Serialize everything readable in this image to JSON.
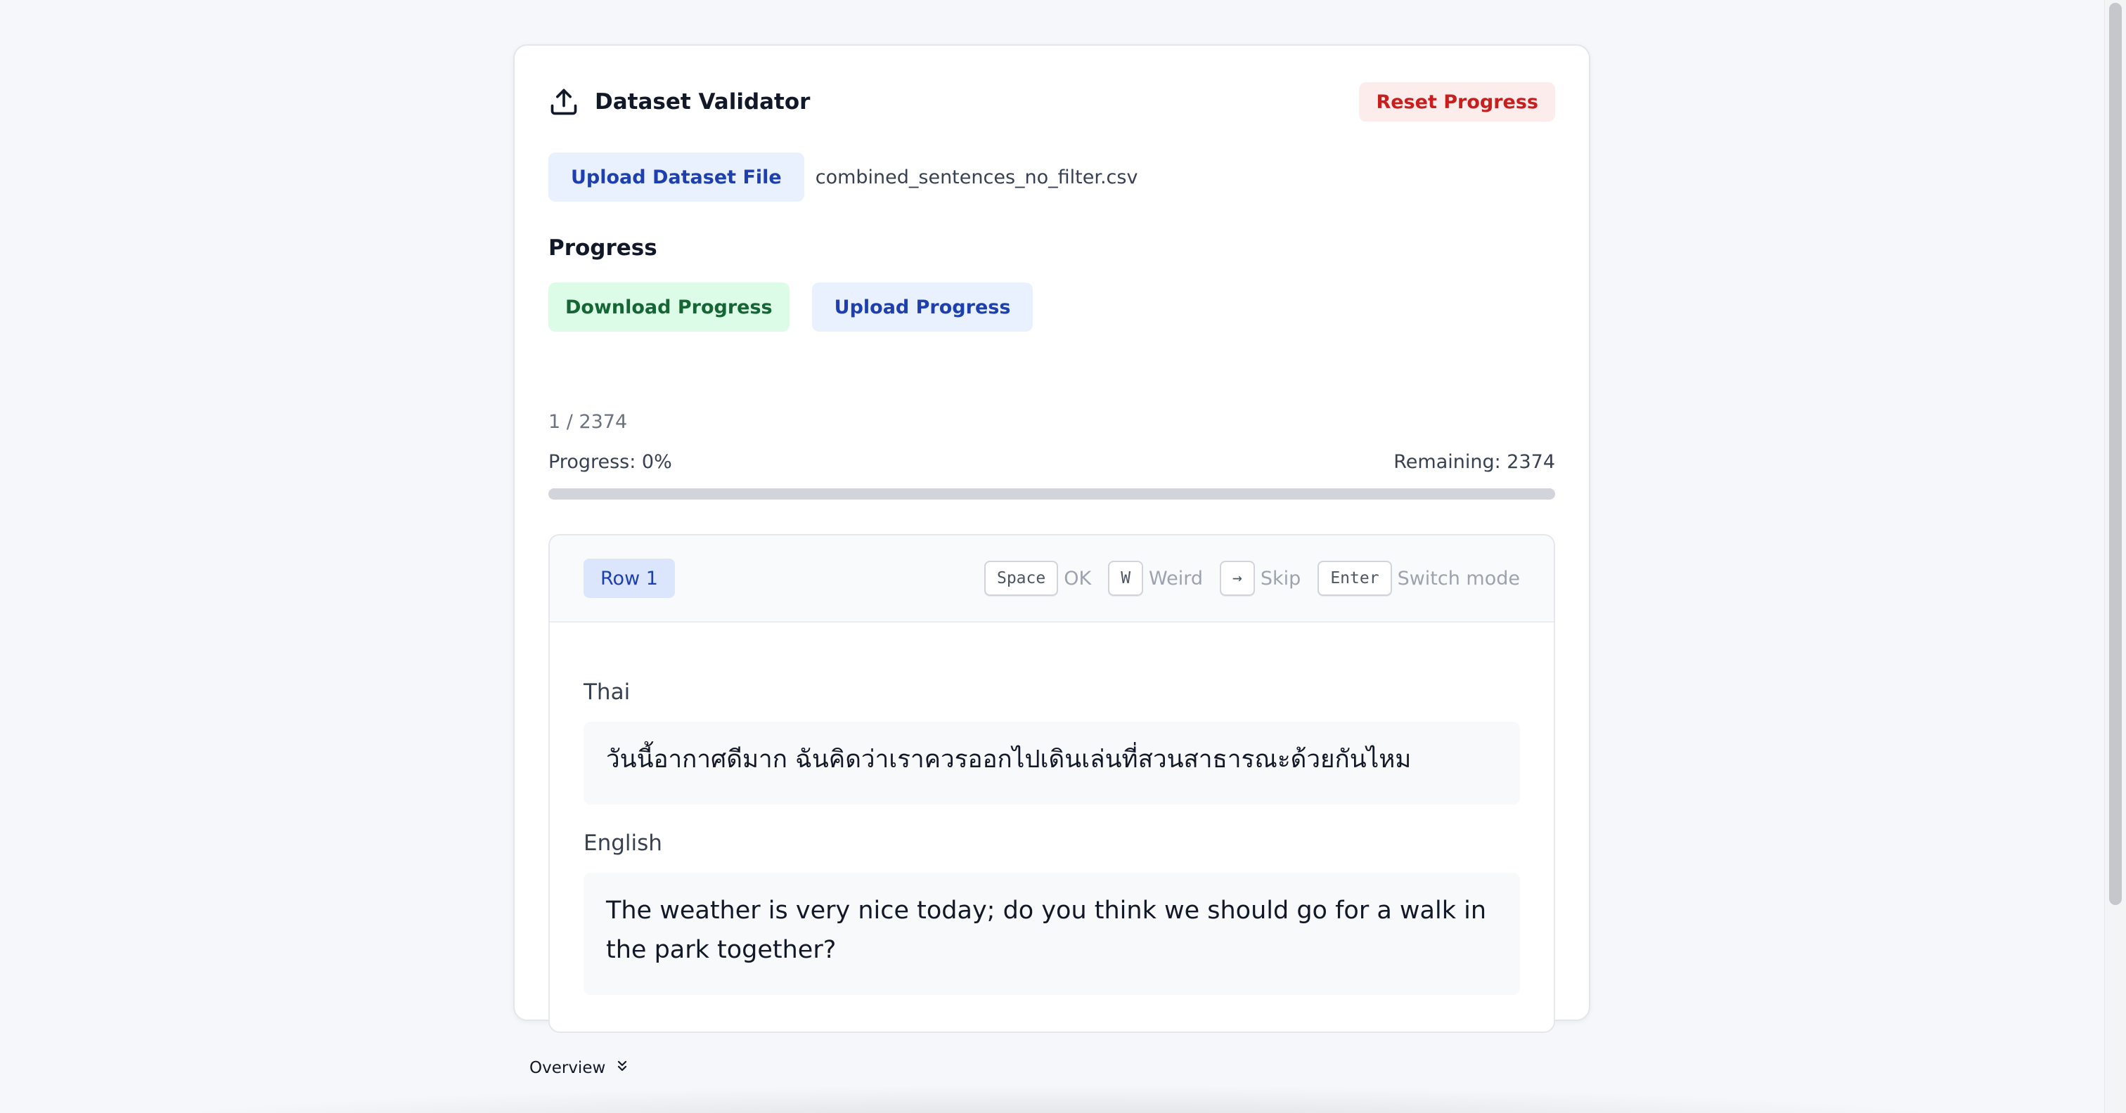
{
  "app": {
    "title": "Dataset Validator",
    "reset_label": "Reset Progress"
  },
  "upload": {
    "button_label": "Upload Dataset File",
    "filename": "combined_sentences_no_filter.csv"
  },
  "progress": {
    "heading": "Progress",
    "download_label": "Download Progress",
    "upload_label": "Upload Progress",
    "counter": "1 / 2374",
    "progress_text": "Progress: 0%",
    "remaining_text": "Remaining: 2374",
    "percent": 0
  },
  "row": {
    "badge": "Row 1",
    "shortcuts": [
      {
        "key": "Space",
        "label": "OK"
      },
      {
        "key": "W",
        "label": "Weird"
      },
      {
        "key": "→",
        "label": "Skip"
      },
      {
        "key": "Enter",
        "label": "Switch mode"
      }
    ],
    "thai_label": "Thai",
    "thai_text": "วันนี้อากาศดีมาก ฉันคิดว่าเราควรออกไปเดินเล่นที่สวนสาธารณะด้วยกันไหม",
    "english_label": "English",
    "english_text": "The weather is very nice today; do you think we should go for a walk in the park together?"
  },
  "footer": {
    "overview_label": "Overview"
  },
  "colors": {
    "accent_blue": "#1e40af",
    "danger_red": "#c81e1e",
    "success_green": "#166534"
  },
  "icons": {
    "title_icon": "upload-icon",
    "overview_icon": "double-chevron-down-icon"
  }
}
